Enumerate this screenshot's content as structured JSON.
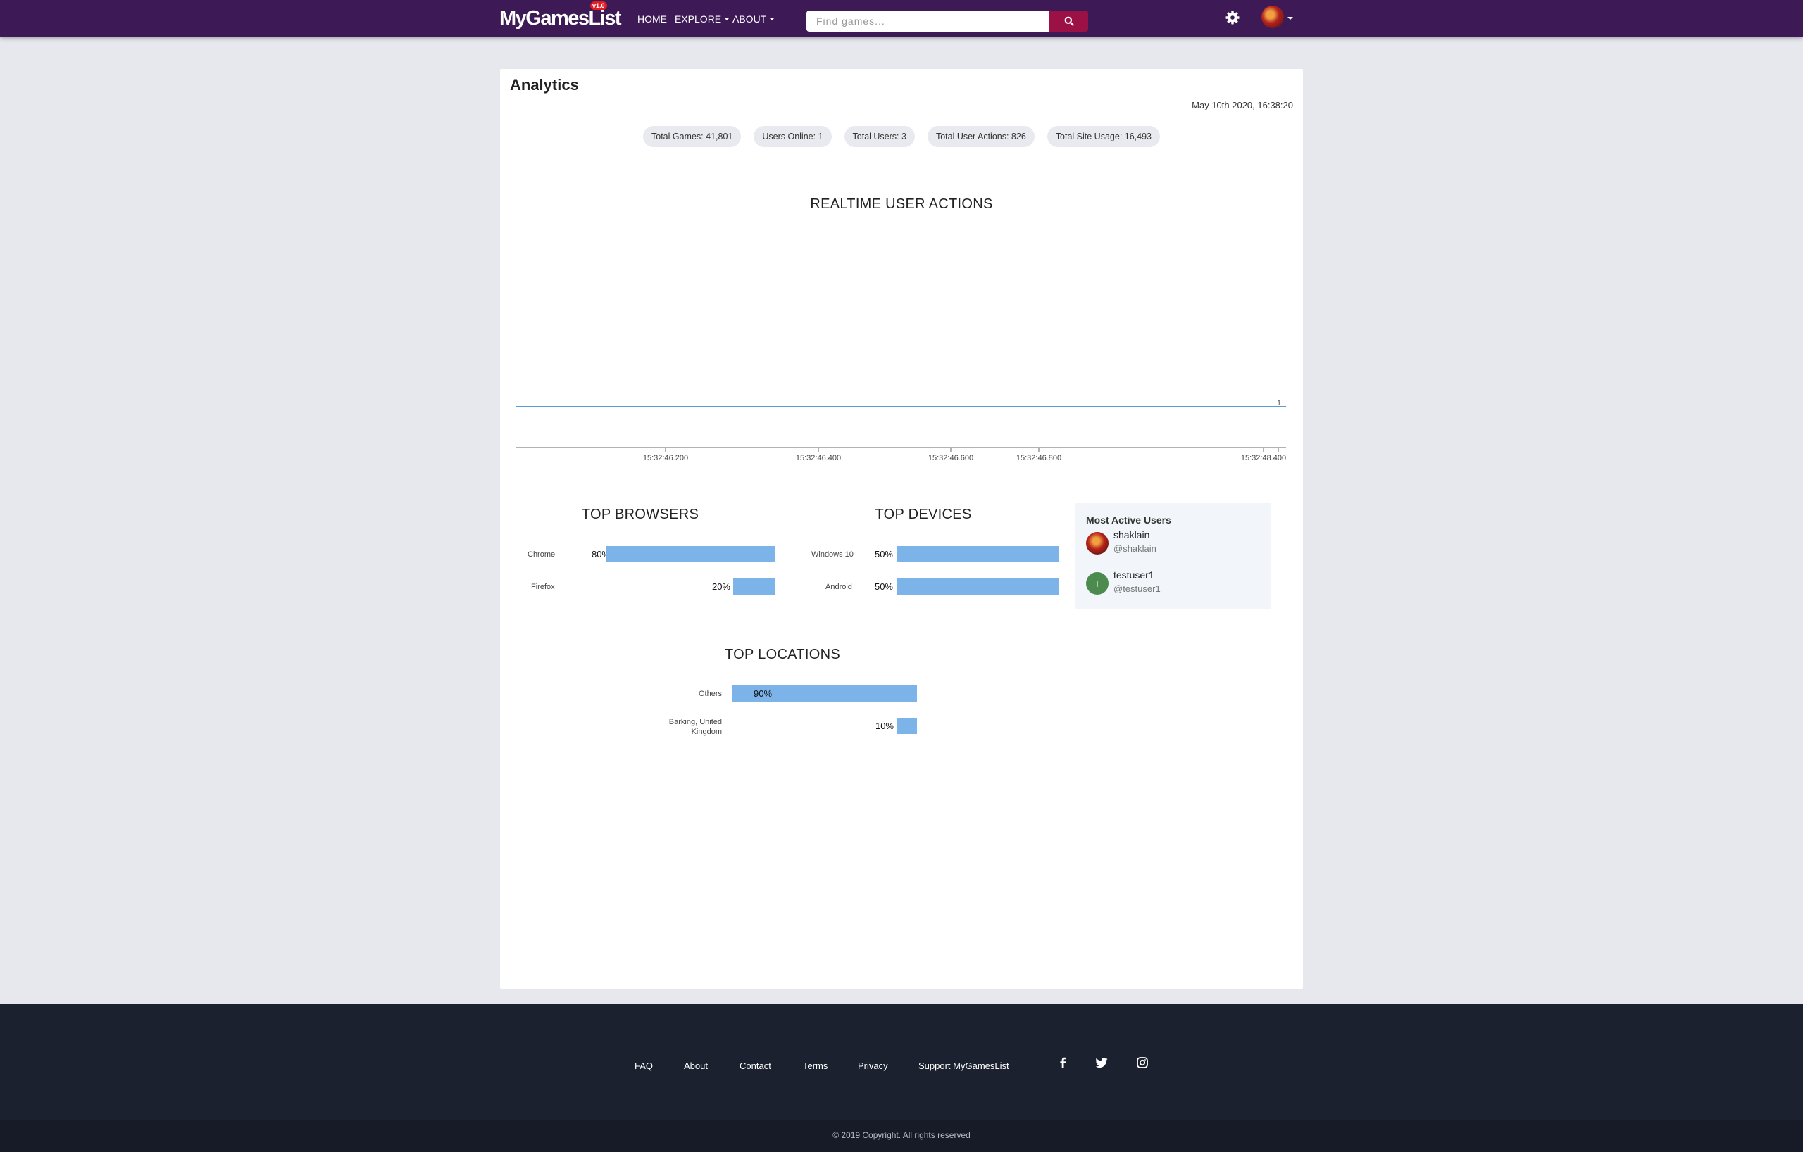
{
  "navbar": {
    "logo": "MyGamesList",
    "version_badge": "v1.0",
    "links": [
      "HOME",
      "EXPLORE",
      "ABOUT"
    ],
    "search_placeholder": "Find games...",
    "icons": [
      "search-icon",
      "gear-icon",
      "avatar"
    ]
  },
  "page": {
    "title": "Analytics",
    "datetime": "May 10th 2020, 16:38:20",
    "stats": [
      "Total Games: 41,801",
      "Users Online: 1",
      "Total Users: 3",
      "Total User Actions: 826",
      "Total Site Usage: 16,493"
    ]
  },
  "chart_data": [
    {
      "type": "line",
      "title": "REALTIME USER ACTIONS",
      "x": [
        "15:32:46.200",
        "15:32:46.400",
        "15:32:46.600",
        "15:32:46.800",
        "15:32:48.400"
      ],
      "series": [
        {
          "values": [
            1,
            1,
            1,
            1,
            1
          ]
        }
      ],
      "end_label": "1",
      "grid": false,
      "color": "#5b9bd5"
    },
    {
      "type": "bar",
      "title": "TOP BROWSERS",
      "categories": [
        "Chrome",
        "Firefox"
      ],
      "values": [
        80,
        20
      ],
      "labels": [
        "80%",
        "20%"
      ],
      "color": "#7cb4ea"
    },
    {
      "type": "bar",
      "title": "TOP DEVICES",
      "categories": [
        "Windows 10",
        "Android"
      ],
      "values": [
        50,
        50
      ],
      "labels": [
        "50%",
        "50%"
      ],
      "color": "#7cb4ea"
    },
    {
      "type": "bar",
      "title": "TOP LOCATIONS",
      "categories": [
        "Others",
        "Barking, United Kingdom"
      ],
      "category_lines": [
        [
          "Others"
        ],
        [
          "Barking, United",
          "Kingdom"
        ]
      ],
      "values": [
        90,
        10
      ],
      "labels": [
        "90%",
        "10%"
      ],
      "color": "#7cb4ea"
    }
  ],
  "active_users": {
    "title": "Most Active Users",
    "users": [
      {
        "name": "shaklain",
        "handle": "@shaklain",
        "avatar": "image"
      },
      {
        "name": "testuser1",
        "handle": "@testuser1",
        "avatar_letter": "T"
      }
    ]
  },
  "footer": {
    "links": [
      "FAQ",
      "About",
      "Contact",
      "Terms",
      "Privacy",
      "Support MyGamesList"
    ],
    "social": [
      "facebook-icon",
      "twitter-icon",
      "instagram-icon"
    ],
    "copyright": "© 2019 Copyright. All rights reserved"
  }
}
